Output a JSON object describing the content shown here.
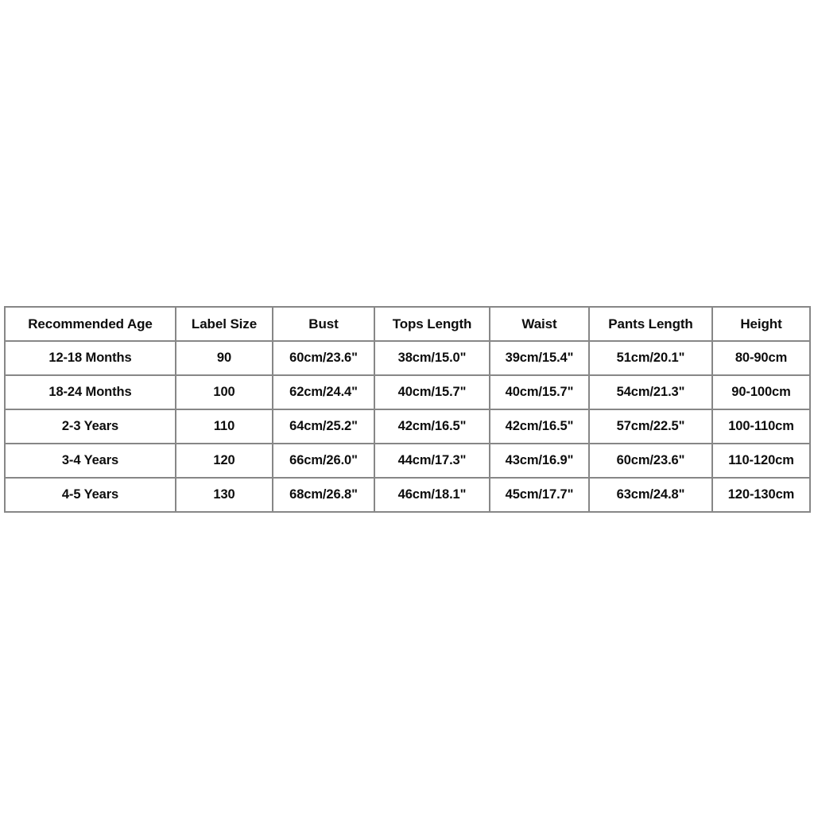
{
  "table": {
    "columns": [
      "Recommended Age",
      "Label Size",
      "Bust",
      "Tops Length",
      "Waist",
      "Pants Length",
      "Height"
    ],
    "rows": [
      {
        "recommended_age": "12-18 Months",
        "label_size": "90",
        "bust": "60cm/23.6\"",
        "tops_length": "38cm/15.0\"",
        "waist": "39cm/15.4\"",
        "pants_length": "51cm/20.1\"",
        "height": "80-90cm"
      },
      {
        "recommended_age": "18-24 Months",
        "label_size": "100",
        "bust": "62cm/24.4\"",
        "tops_length": "40cm/15.7\"",
        "waist": "40cm/15.7\"",
        "pants_length": "54cm/21.3\"",
        "height": "90-100cm"
      },
      {
        "recommended_age": "2-3 Years",
        "label_size": "110",
        "bust": "64cm/25.2\"",
        "tops_length": "42cm/16.5\"",
        "waist": "42cm/16.5\"",
        "pants_length": "57cm/22.5\"",
        "height": "100-110cm"
      },
      {
        "recommended_age": "3-4 Years",
        "label_size": "120",
        "bust": "66cm/26.0\"",
        "tops_length": "44cm/17.3\"",
        "waist": "43cm/16.9\"",
        "pants_length": "60cm/23.6\"",
        "height": "110-120cm"
      },
      {
        "recommended_age": "4-5 Years",
        "label_size": "130",
        "bust": "68cm/26.8\"",
        "tops_length": "46cm/18.1\"",
        "waist": "45cm/17.7\"",
        "pants_length": "63cm/24.8\"",
        "height": "120-130cm"
      }
    ]
  },
  "colors": {
    "background": "#ffffff",
    "border": "#878787",
    "text": "#0d0d0d"
  }
}
